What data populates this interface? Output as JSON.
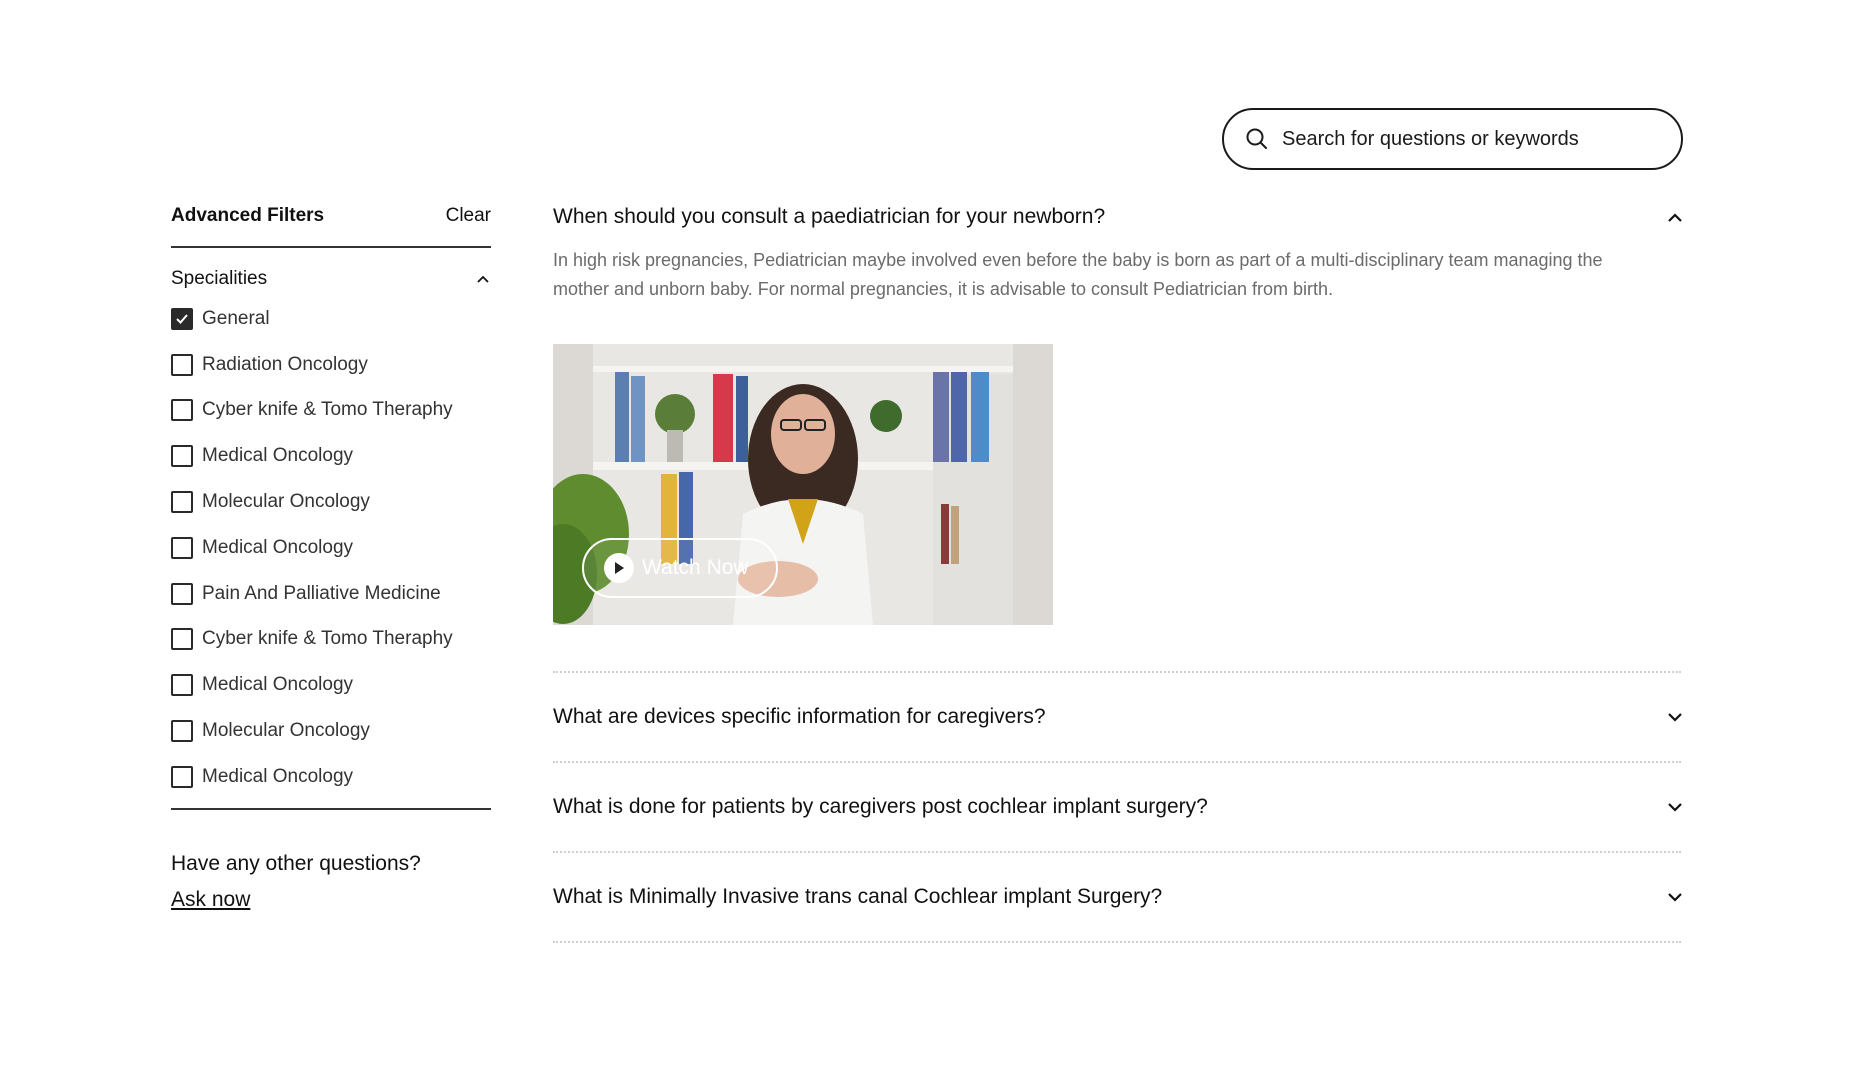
{
  "search": {
    "placeholder": "Search for questions or keywords",
    "icon": "search-icon"
  },
  "sidebar": {
    "title": "Advanced Filters",
    "clear_label": "Clear",
    "specialities": {
      "title": "Specialities",
      "items": [
        {
          "label": "General",
          "checked": true
        },
        {
          "label": "Radiation Oncology",
          "checked": false
        },
        {
          "label": "Cyber knife & Tomo Theraphy",
          "checked": false
        },
        {
          "label": "Medical Oncology",
          "checked": false
        },
        {
          "label": "Molecular Oncology",
          "checked": false
        },
        {
          "label": "Medical Oncology",
          "checked": false
        },
        {
          "label": "Pain And Palliative Medicine",
          "checked": false
        },
        {
          "label": "Cyber knife & Tomo Theraphy",
          "checked": false
        },
        {
          "label": "Medical Oncology",
          "checked": false
        },
        {
          "label": "Molecular Oncology",
          "checked": false
        },
        {
          "label": "Medical Oncology",
          "checked": false
        }
      ]
    },
    "other_questions": "Have any other questions?",
    "ask_now": "Ask now"
  },
  "faq": {
    "items": [
      {
        "question": "When should you consult a paediatrician for your newborn?",
        "answer": "In high risk pregnancies, Pediatrician maybe involved even before the baby is born as part of a multi-disciplinary team managing the mother and unborn baby. For normal pregnancies, it is advisable to consult Pediatrician from birth.",
        "expanded": true,
        "video_button": "Watch Now"
      },
      {
        "question": "What are devices specific information for caregivers?",
        "expanded": false
      },
      {
        "question": "What is done for patients by caregivers post cochlear implant surgery?",
        "expanded": false
      },
      {
        "question": "What is Minimally Invasive trans canal Cochlear implant Surgery?",
        "expanded": false
      }
    ]
  },
  "colors": {
    "text": "#111111",
    "muted": "#6b6b6b",
    "border": "#1a1a1a",
    "divider": "#cfcfcf"
  }
}
